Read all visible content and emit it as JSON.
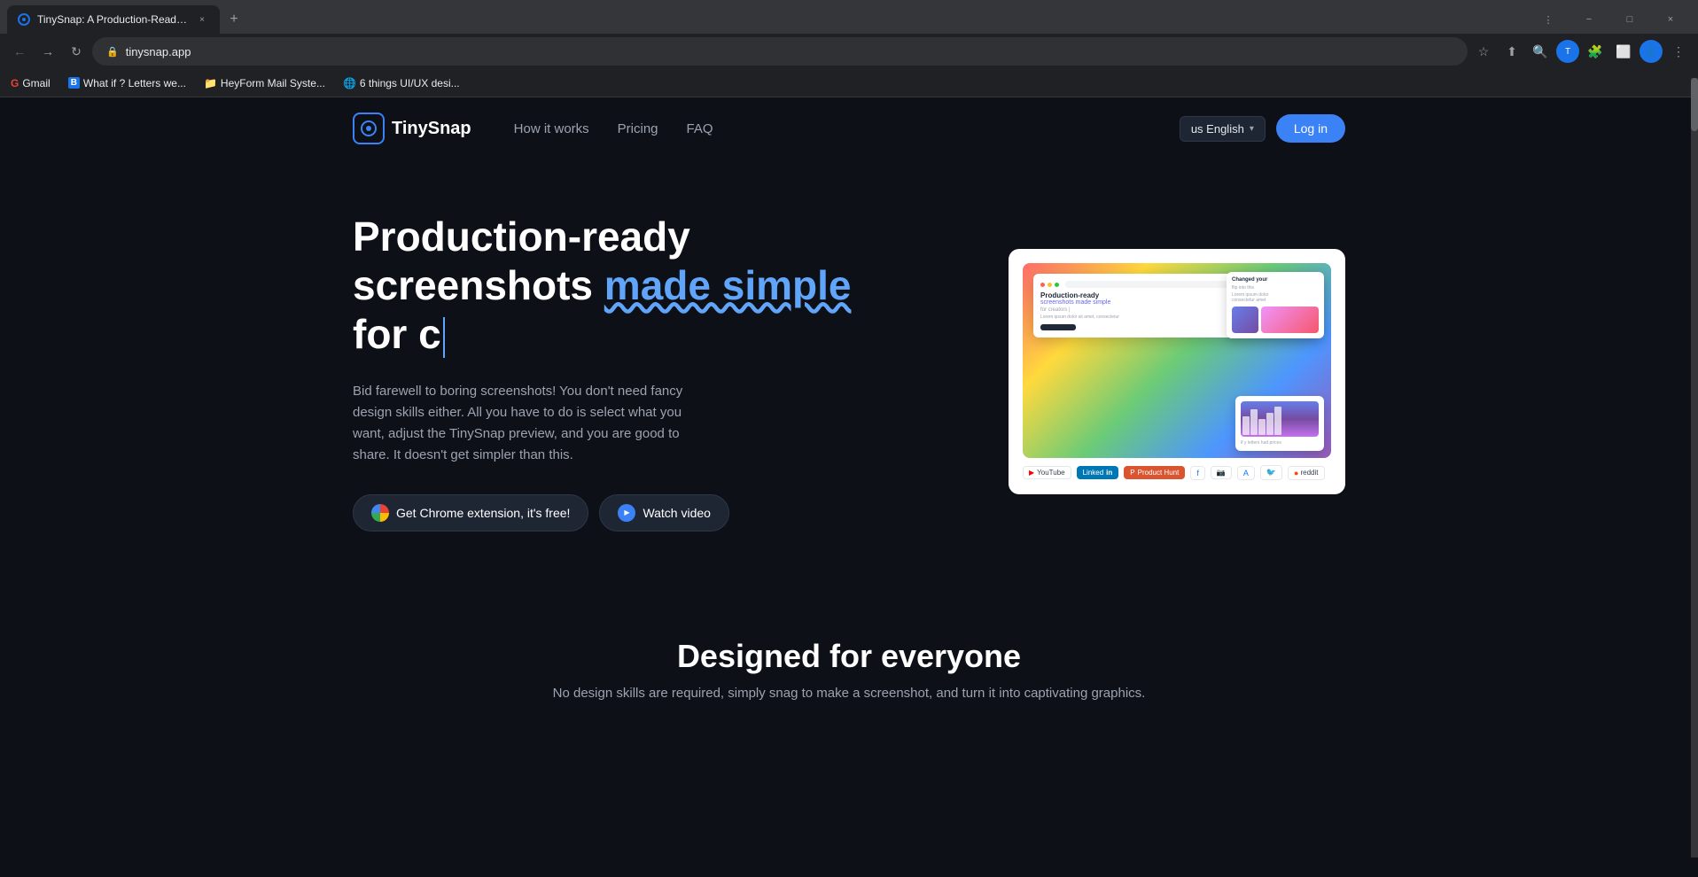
{
  "browser": {
    "tab": {
      "title": "TinySnap: A Production-Ready S...",
      "favicon_color": "#1a73e8",
      "url": "tinysnap.app"
    },
    "new_tab_label": "+",
    "window_controls": {
      "minimize": "−",
      "maximize": "□",
      "close": "×",
      "more": "⋮"
    },
    "nav": {
      "back": "←",
      "forward": "→",
      "reload": "↻",
      "lock": "🔒"
    },
    "bookmarks": [
      {
        "id": "gmail",
        "label": "Gmail",
        "favicon": "G",
        "color": "#ea4335"
      },
      {
        "id": "whatif",
        "label": "What if ? Letters we...",
        "favicon": "B",
        "color": "#1a73e8"
      },
      {
        "id": "heyform",
        "label": "HeyForm Mail Syste...",
        "favicon": "📁",
        "color": "#fbbf24"
      },
      {
        "id": "uxdesign",
        "label": "6 things UI/UX desi...",
        "favicon": "🌐",
        "color": "#34a853"
      }
    ]
  },
  "site": {
    "logo_text": "TinySnap",
    "nav": {
      "how_it_works": "How it works",
      "pricing": "Pricing",
      "faq": "FAQ"
    },
    "lang_button": "us English",
    "lang_chevron": "▾",
    "login_button": "Log in",
    "hero": {
      "title_line1": "Production-ready",
      "title_line2": "screenshots ",
      "title_highlight": "made simple",
      "title_line3": "for c",
      "description": "Bid farewell to boring screenshots! You don't need fancy design skills either. All you have to do is select what you want, adjust the TinySnap preview, and you are good to share. It doesn't get simpler than this.",
      "btn_chrome": "Get Chrome extension, it's free!",
      "btn_watch": "Watch video"
    },
    "preview": {
      "inner_title": "Production-ready",
      "inner_subtitle": "screenshots made simple",
      "inner_text": "for creators |",
      "social_badges": [
        {
          "label": "YouTube",
          "icon": "▶"
        },
        {
          "label": "LinkedIn",
          "icon": "in"
        },
        {
          "label": "Product Hunt",
          "icon": "P"
        },
        {
          "label": "Facebook",
          "icon": "f"
        },
        {
          "label": "Instagram",
          "icon": "📷"
        },
        {
          "label": "App Store",
          "icon": "A"
        },
        {
          "label": "Twitter",
          "icon": "🐦"
        },
        {
          "label": "Reddit",
          "icon": "r/"
        }
      ]
    },
    "bottom": {
      "title": "Designed for everyone",
      "description": "No design skills are required, simply snag to make a screenshot, and turn it into captivating graphics."
    }
  }
}
